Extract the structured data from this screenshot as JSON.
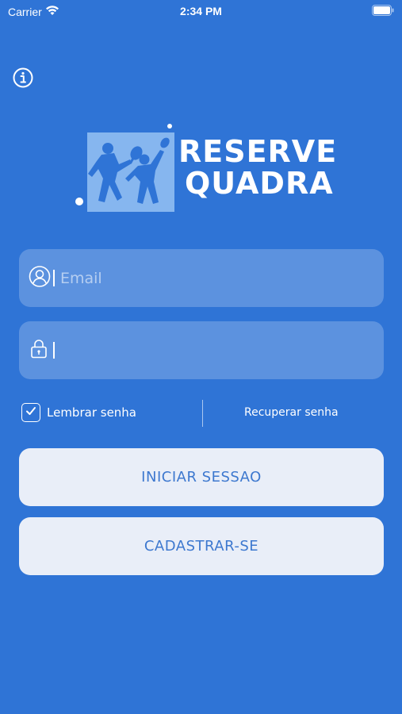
{
  "status_bar": {
    "carrier": "Carrier",
    "time": "2:34 PM",
    "wifi_icon": "wifi-icon",
    "battery_icon": "battery-icon"
  },
  "info_icon": "info-icon",
  "logo": {
    "line1": "RESERVE",
    "line2": "QUADRA",
    "image": "tennis-players-icon"
  },
  "email_field": {
    "placeholder": "Email",
    "value": "",
    "icon": "user-icon"
  },
  "password_field": {
    "placeholder": "",
    "value": "",
    "icon": "lock-icon"
  },
  "remember": {
    "label": "Lembrar senha",
    "checked": true
  },
  "recover_link": "Recuperar senha",
  "buttons": {
    "login": "INICIAR SESSAO",
    "signup": "CADASTRAR-SE"
  },
  "colors": {
    "background": "#2f74d6",
    "field_bg": "rgba(255,255,255,0.22)",
    "button_bg": "#e9eef8",
    "button_text": "#3d78cf",
    "logo_box": "#86b6ef"
  }
}
